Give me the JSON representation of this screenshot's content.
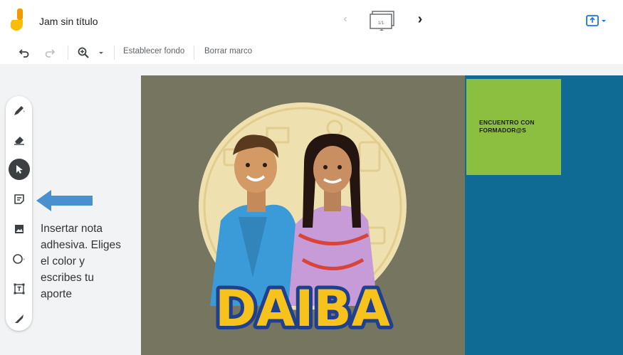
{
  "app": {
    "title": "Jam sin título",
    "logo_icon": "jamboard-logo-icon"
  },
  "navigation": {
    "prev_icon": "chevron-left-icon",
    "next_icon": "chevron-right-icon",
    "frame_icon": "frame-bar-icon",
    "frame_counter": "1/1"
  },
  "share": {
    "icon": "share-upload-icon"
  },
  "toolbar": {
    "undo_icon": "undo-icon",
    "redo_icon": "redo-icon",
    "zoom_icon": "zoom-icon",
    "set_background_label": "Establecer fondo",
    "clear_frame_label": "Borrar marco"
  },
  "tools": [
    {
      "name": "pen",
      "icon": "pen-icon"
    },
    {
      "name": "eraser",
      "icon": "eraser-icon"
    },
    {
      "name": "select",
      "icon": "cursor-icon",
      "active": true
    },
    {
      "name": "sticky-note",
      "icon": "sticky-note-icon"
    },
    {
      "name": "image",
      "icon": "image-icon"
    },
    {
      "name": "circle",
      "icon": "circle-icon"
    },
    {
      "name": "text-box",
      "icon": "text-box-icon"
    },
    {
      "name": "laser",
      "icon": "laser-icon"
    }
  ],
  "annotation": {
    "lines": [
      "Insertar nota",
      "adhesiva. Eliges",
      "el color y",
      "escribes tu",
      "aporte"
    ],
    "arrow_color": "#4a8fd0"
  },
  "sticky_note": {
    "lines": [
      "ENCUENTRO CON",
      "FORMADOR@S"
    ],
    "color": "#8cbf3f"
  },
  "board": {
    "background_color": "#757560",
    "panel_color": "#0f6b93",
    "illustration_logo": "DAIBA"
  },
  "colors": {
    "accent": "#1a73e8",
    "logo_yellow": "#fbbc04",
    "logo_orange": "#f29900"
  }
}
